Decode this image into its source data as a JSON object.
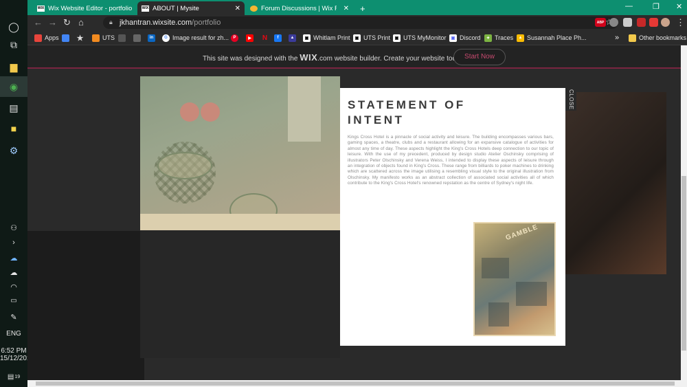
{
  "taskbar": {
    "time": "6:52 PM",
    "date": "15/12/2019",
    "language": "ENG",
    "notification_count": "19"
  },
  "tabs": [
    {
      "favicon": "WIX",
      "label": "Wix Website Editor - portfolio"
    },
    {
      "favicon": "WIX",
      "label": "ABOUT | Mysite"
    },
    {
      "favicon": "",
      "label": "Forum Discussions | Wix Forum"
    }
  ],
  "new_tab_icon": "+",
  "omnibox": {
    "domain": "jkhantran.wixsite.com",
    "path": "/portfolio"
  },
  "extensions": [
    {
      "label": "ABP",
      "color": "#d0021b"
    },
    {
      "label": "",
      "color": "#888888"
    },
    {
      "label": "",
      "color": "#cccccc"
    },
    {
      "label": "",
      "color": "#c62828"
    },
    {
      "label": "",
      "color": "#e53935"
    }
  ],
  "bookmarks": [
    {
      "label": "Apps",
      "icon": "apps-icon",
      "color": "#e8453c"
    },
    {
      "label": "",
      "icon": "docs-icon",
      "color": "#4285f4"
    },
    {
      "label": "",
      "icon": "star-icon",
      "color": "#2b2b2b"
    },
    {
      "label": "UTS",
      "icon": "uts-icon",
      "color": "#f28b20"
    },
    {
      "label": "",
      "icon": "uts-logo-icon",
      "color": "#555555"
    },
    {
      "label": "",
      "icon": "bookmark-icon",
      "color": "#666666"
    },
    {
      "label": "",
      "icon": "linkedin-icon",
      "color": "#0a66c2"
    },
    {
      "label": "Image result for zh...",
      "icon": "google-icon",
      "color": "#ffffff"
    },
    {
      "label": "",
      "icon": "pinterest-icon",
      "color": "#e60023"
    },
    {
      "label": "",
      "icon": "youtube-icon",
      "color": "#ff0000"
    },
    {
      "label": "",
      "icon": "netflix-icon",
      "color": "#e50914"
    },
    {
      "label": "",
      "icon": "facebook-icon",
      "color": "#1877f2"
    },
    {
      "label": "",
      "icon": "triangle-icon",
      "color": "#3b3b9a"
    },
    {
      "label": "Whitlam Print",
      "icon": "print-icon",
      "color": "#ffffff"
    },
    {
      "label": "UTS Print",
      "icon": "print-icon",
      "color": "#ffffff"
    },
    {
      "label": "UTS MyMonitor",
      "icon": "monitor-icon",
      "color": "#ffffff"
    },
    {
      "label": "Discord",
      "icon": "discord-icon",
      "color": "#ffffff"
    },
    {
      "label": "Traces",
      "icon": "traces-icon",
      "color": "#7cb342"
    },
    {
      "label": "Susannah Place Ph...",
      "icon": "drive-icon",
      "color": "#fbbc04"
    },
    {
      "label": "»",
      "icon": "more-icon",
      "color": "#2b2b2b"
    },
    {
      "label": "Other bookmarks",
      "icon": "folder-icon",
      "color": "#f2c94c"
    }
  ],
  "banner": {
    "text_before": "This site was designed with the ",
    "brand": "WIX",
    "text_after": ".com website builder. Create your website today.",
    "button": "Start Now"
  },
  "lightbox": {
    "close_label": "CLOSE",
    "title": "STATEMENT OF INTENT",
    "body": "Kings Cross Hotel is a pinnacle of social activity and leisure. The building encompasses various bars, gaming spaces, a theatre, clubs and a restaurant allowing for an expansive catalogue of activities for almost any time of day. These aspects highlight the King's Cross Hotels deep connection to our topic of leisure. With the use of my precedent, produced by design studio Atelier Oschinsky comprising of illustrators Peter Olschinsky and Verena Weiss, I intended to display these aspects of leisure through an integration of objects found in King's Cross. These range from billiards to poker machines to drinking which are scattered across the image utilising a resembling visual style to the original illustration from Olschinsky. My manifesto works as an abstract collection of associated social activities all of which contribute to the King's Cross Hotel's renowned repstation as the centre of Sydney's night life.",
    "art_word": "GAMBLE"
  },
  "colors": {
    "chrome_tab_strip": "#0d8f70",
    "banner_accent": "#7a2540",
    "start_now_text": "#c74a6f"
  }
}
